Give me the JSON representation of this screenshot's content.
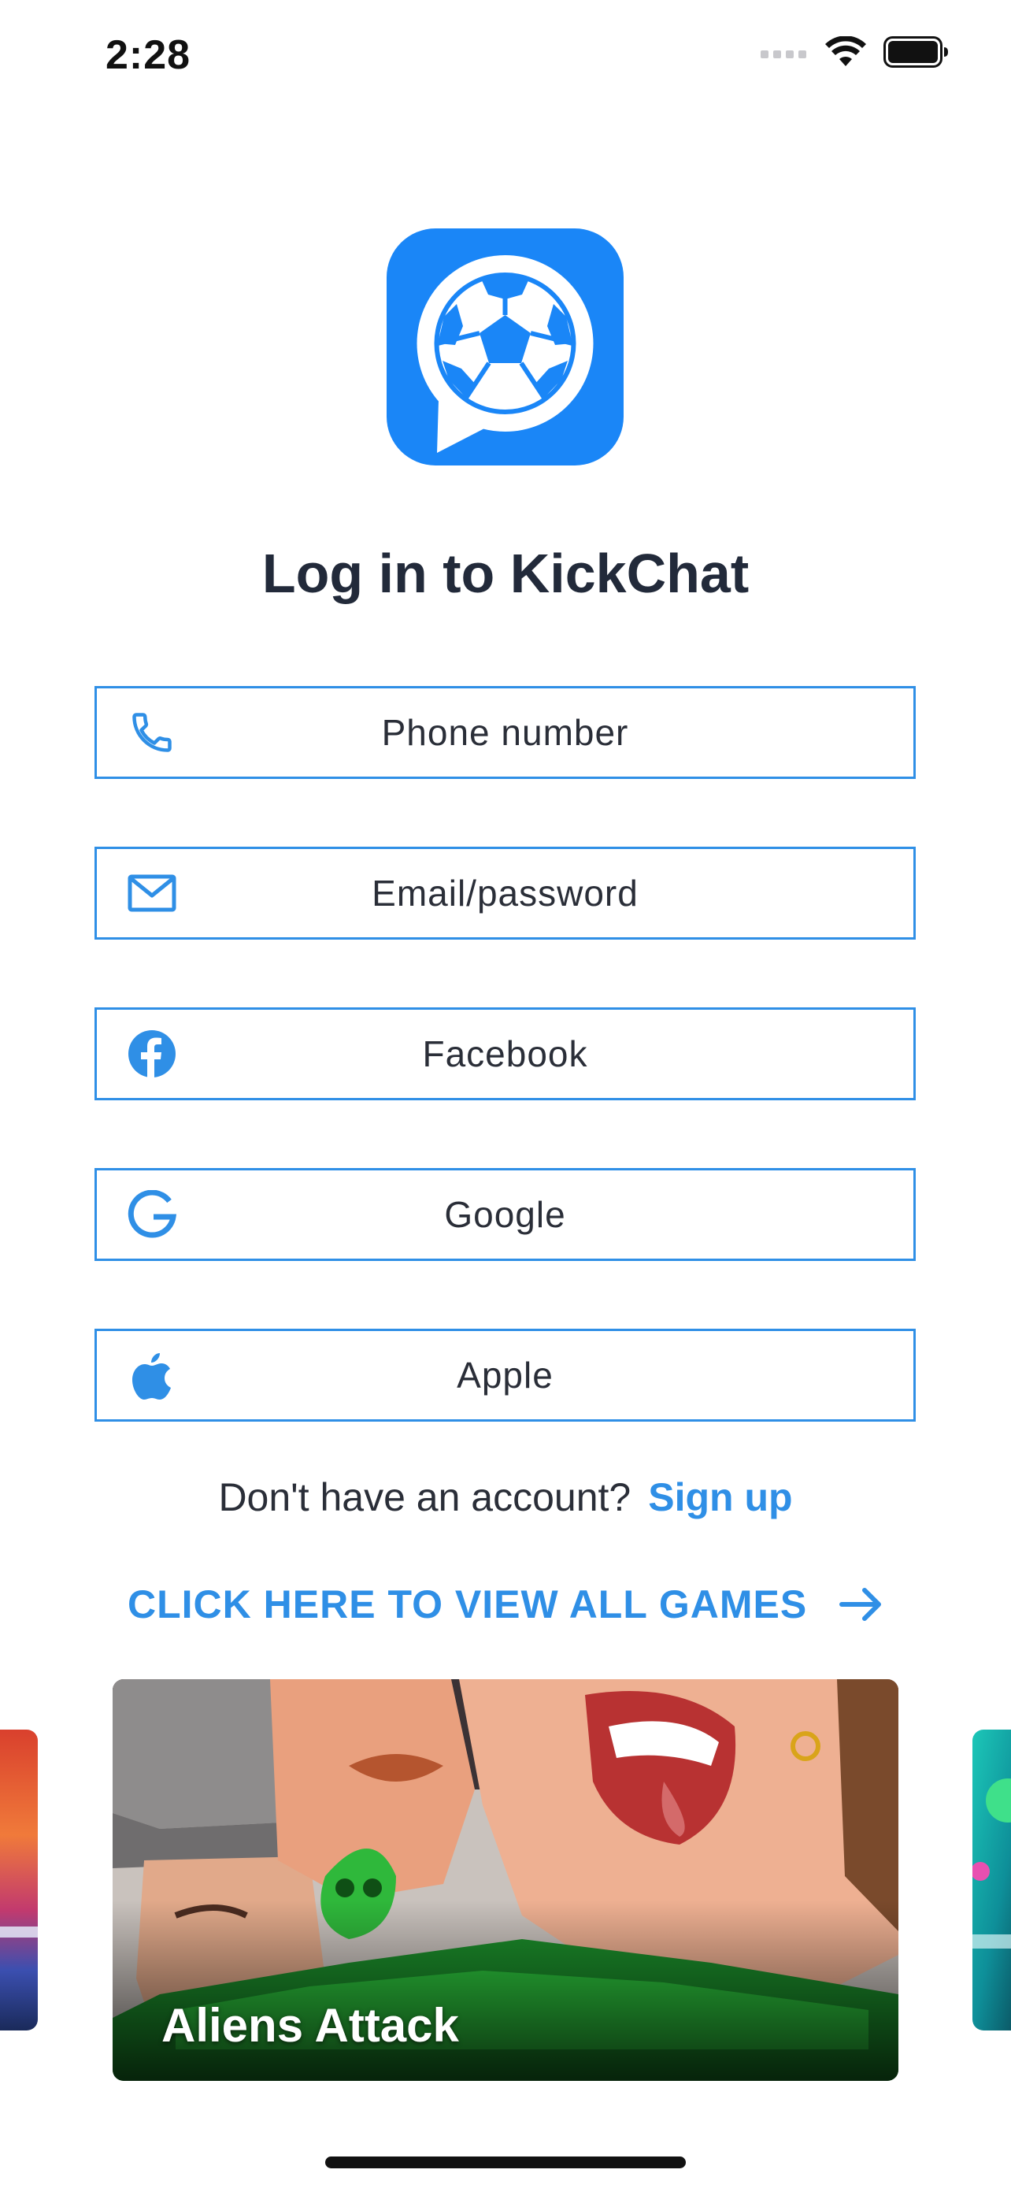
{
  "status_bar": {
    "time": "2:28"
  },
  "title": "Log in to KickChat",
  "login_options": [
    {
      "label": "Phone number",
      "icon": "phone-icon"
    },
    {
      "label": "Email/password",
      "icon": "mail-icon"
    },
    {
      "label": "Facebook",
      "icon": "facebook-icon"
    },
    {
      "label": "Google",
      "icon": "google-icon"
    },
    {
      "label": "Apple",
      "icon": "apple-icon"
    }
  ],
  "signup": {
    "prompt": "Don't have an account?",
    "link": "Sign up"
  },
  "view_games": {
    "label": "CLICK HERE TO VIEW ALL GAMES",
    "icon": "arrow-right-icon"
  },
  "games": {
    "featured_title": "Aliens Attack"
  },
  "colors": {
    "accent": "#2f8fe6",
    "logo_blue": "#1a86f7",
    "title_text": "#222a3a"
  }
}
